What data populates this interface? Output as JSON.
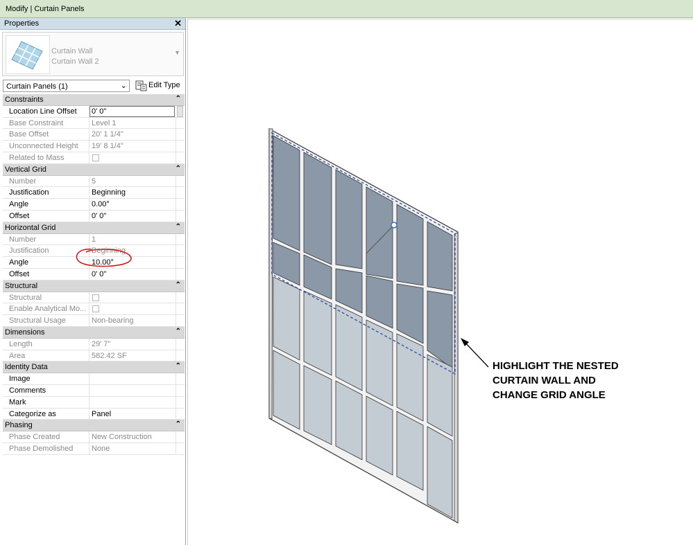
{
  "window": {
    "title": "Modify | Curtain Panels"
  },
  "properties": {
    "header": "Properties",
    "close_label": "✕",
    "type_selector": {
      "family": "Curtain Wall",
      "type": "Curtain Wall 2"
    },
    "filter": {
      "label": "Curtain Panels (1)"
    },
    "edit_type_label": "Edit Type",
    "sections": {
      "constraints": {
        "title": "Constraints",
        "location_line_offset": {
          "label": "Location Line Offset",
          "value": "0'  0\""
        },
        "base_constraint": {
          "label": "Base Constraint",
          "value": "Level 1"
        },
        "base_offset": {
          "label": "Base Offset",
          "value": "20'  1 1/4\""
        },
        "unconnected_height": {
          "label": "Unconnected Height",
          "value": "19'  8 1/4\""
        },
        "related_to_mass": {
          "label": "Related to Mass",
          "checked": false
        }
      },
      "vertical_grid": {
        "title": "Vertical Grid",
        "number": {
          "label": "Number",
          "value": "5"
        },
        "justification": {
          "label": "Justification",
          "value": "Beginning"
        },
        "angle": {
          "label": "Angle",
          "value": "0.00°"
        },
        "offset": {
          "label": "Offset",
          "value": "0'  0\""
        }
      },
      "horizontal_grid": {
        "title": "Horizontal Grid",
        "number": {
          "label": "Number",
          "value": "1"
        },
        "justification": {
          "label": "Justification",
          "value": "Beginning"
        },
        "angle": {
          "label": "Angle",
          "value": "10.00°"
        },
        "offset": {
          "label": "Offset",
          "value": "0'  0\""
        }
      },
      "structural": {
        "title": "Structural",
        "structural": {
          "label": "Structural",
          "checked": false
        },
        "enable_analytical": {
          "label": "Enable Analytical Mo...",
          "checked": false
        },
        "structural_usage": {
          "label": "Structural Usage",
          "value": "Non-bearing"
        }
      },
      "dimensions": {
        "title": "Dimensions",
        "length": {
          "label": "Length",
          "value": "29'  7\""
        },
        "area": {
          "label": "Area",
          "value": "582.42 SF"
        }
      },
      "identity_data": {
        "title": "Identity Data",
        "image": {
          "label": "Image",
          "value": ""
        },
        "comments": {
          "label": "Comments",
          "value": ""
        },
        "mark": {
          "label": "Mark",
          "value": ""
        },
        "categorize_as": {
          "label": "Categorize as",
          "value": "Panel"
        }
      },
      "phasing": {
        "title": "Phasing",
        "phase_created": {
          "label": "Phase Created",
          "value": "New Construction"
        },
        "phase_demolished": {
          "label": "Phase Demolished",
          "value": "None"
        }
      }
    }
  },
  "annotation": {
    "line1": "HIGHLIGHT THE NESTED",
    "line2": "CURTAIN WALL AND",
    "line3": "CHANGE GRID ANGLE"
  },
  "icons": {
    "type_thumbnail": "curtain-wall-thumbnail-icon",
    "edit_type": "edit-type-icon",
    "collapse": "collapse-chevron-icon"
  },
  "colors": {
    "title_bar": "#d6e6cf",
    "panel_header": "#cfdde9",
    "category_row": "#d8d8d8",
    "highlight_circle": "#d11a1a",
    "selected_panel": "#8797a6",
    "glass_panel": "#bdc8d0",
    "selection_outline": "#3a53a8"
  }
}
